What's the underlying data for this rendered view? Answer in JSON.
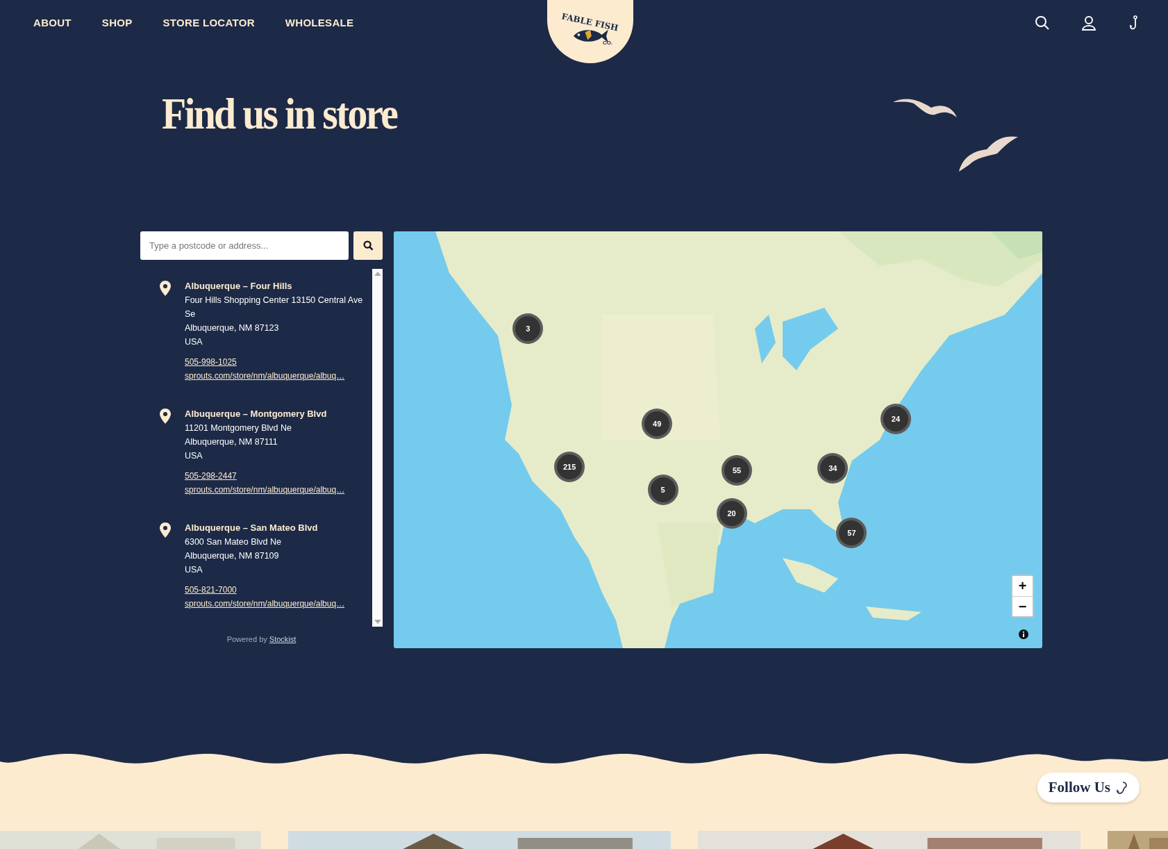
{
  "nav": {
    "links": [
      {
        "label": "ABOUT"
      },
      {
        "label": "SHOP"
      },
      {
        "label": "STORE LOCATOR"
      },
      {
        "label": "WHOLESALE"
      }
    ]
  },
  "logo": {
    "name": "FABLE FISH",
    "suffix": "CO."
  },
  "heading": "Find us in store",
  "search": {
    "placeholder": "Type a postcode or address..."
  },
  "stores": [
    {
      "name": "Albuquerque – Four Hills",
      "address_lines": [
        "Four Hills Shopping Center 13150 Central Ave Se",
        "Albuquerque, NM 87123",
        "USA"
      ],
      "phone": "505-998-1025",
      "url": "sprouts.com/store/nm/albuquerque/albuq…"
    },
    {
      "name": "Albuquerque – Montgomery Blvd",
      "address_lines": [
        "11201 Montgomery Blvd Ne",
        "Albuquerque, NM 87111",
        "USA"
      ],
      "phone": "505-298-2447",
      "url": "sprouts.com/store/nm/albuquerque/albuq…"
    },
    {
      "name": "Albuquerque – San Mateo Blvd",
      "address_lines": [
        "6300 San Mateo Blvd Ne",
        "Albuquerque, NM 87109",
        "USA"
      ],
      "phone": "505-821-7000",
      "url": "sprouts.com/store/nm/albuquerque/albuq…"
    }
  ],
  "powered_by": {
    "text": "Powered by",
    "link": "Stockist"
  },
  "map": {
    "kind": "picture",
    "clusters": [
      {
        "count": "3"
      },
      {
        "count": "49"
      },
      {
        "count": "215"
      },
      {
        "count": "5"
      },
      {
        "count": "55"
      },
      {
        "count": "20"
      },
      {
        "count": "34"
      },
      {
        "count": "24"
      },
      {
        "count": "57"
      }
    ],
    "zoom_in": "+",
    "zoom_out": "−"
  },
  "follow_button": "Follow Us"
}
